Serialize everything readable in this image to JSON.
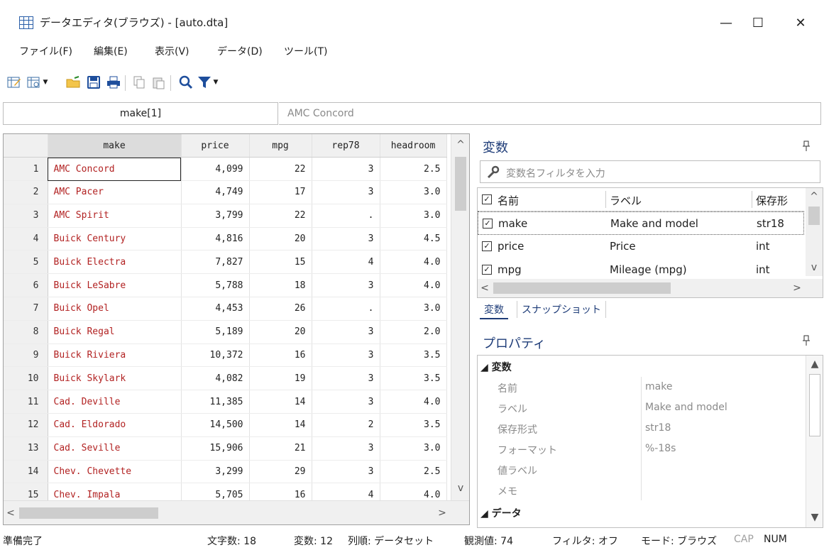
{
  "window": {
    "title": "データエディタ(ブラウズ) - [auto.dta]",
    "minimize": "—",
    "maximize": "☐",
    "close": "✕"
  },
  "menu": [
    "ファイル(F)",
    "編集(E)",
    "表示(V)",
    "データ(D)",
    "ツール(T)"
  ],
  "toolbar": {
    "icons": [
      "data-editor-edit-icon",
      "data-editor-browse-icon",
      "open-folder-icon",
      "save-icon",
      "print-icon",
      "copy-icon",
      "paste-icon",
      "search-icon",
      "filter-icon"
    ]
  },
  "cellbar": {
    "varname": "make[1]",
    "value": "AMC Concord"
  },
  "grid": {
    "columns": [
      "make",
      "price",
      "mpg",
      "rep78",
      "headroom"
    ],
    "rows": [
      {
        "n": "1",
        "make": "AMC Concord",
        "price": "4,099",
        "mpg": "22",
        "rep78": "3",
        "headroom": "2.5"
      },
      {
        "n": "2",
        "make": "AMC Pacer",
        "price": "4,749",
        "mpg": "17",
        "rep78": "3",
        "headroom": "3.0"
      },
      {
        "n": "3",
        "make": "AMC Spirit",
        "price": "3,799",
        "mpg": "22",
        "rep78": ".",
        "headroom": "3.0"
      },
      {
        "n": "4",
        "make": "Buick Century",
        "price": "4,816",
        "mpg": "20",
        "rep78": "3",
        "headroom": "4.5"
      },
      {
        "n": "5",
        "make": "Buick Electra",
        "price": "7,827",
        "mpg": "15",
        "rep78": "4",
        "headroom": "4.0"
      },
      {
        "n": "6",
        "make": "Buick LeSabre",
        "price": "5,788",
        "mpg": "18",
        "rep78": "3",
        "headroom": "4.0"
      },
      {
        "n": "7",
        "make": "Buick Opel",
        "price": "4,453",
        "mpg": "26",
        "rep78": ".",
        "headroom": "3.0"
      },
      {
        "n": "8",
        "make": "Buick Regal",
        "price": "5,189",
        "mpg": "20",
        "rep78": "3",
        "headroom": "2.0"
      },
      {
        "n": "9",
        "make": "Buick Riviera",
        "price": "10,372",
        "mpg": "16",
        "rep78": "3",
        "headroom": "3.5"
      },
      {
        "n": "10",
        "make": "Buick Skylark",
        "price": "4,082",
        "mpg": "19",
        "rep78": "3",
        "headroom": "3.5"
      },
      {
        "n": "11",
        "make": "Cad. Deville",
        "price": "11,385",
        "mpg": "14",
        "rep78": "3",
        "headroom": "4.0"
      },
      {
        "n": "12",
        "make": "Cad. Eldorado",
        "price": "14,500",
        "mpg": "14",
        "rep78": "2",
        "headroom": "3.5"
      },
      {
        "n": "13",
        "make": "Cad. Seville",
        "price": "15,906",
        "mpg": "21",
        "rep78": "3",
        "headroom": "3.0"
      },
      {
        "n": "14",
        "make": "Chev. Chevette",
        "price": "3,299",
        "mpg": "29",
        "rep78": "3",
        "headroom": "2.5"
      },
      {
        "n": "15",
        "make": "Chev. Impala",
        "price": "5,705",
        "mpg": "16",
        "rep78": "4",
        "headroom": "4.0"
      }
    ]
  },
  "variables": {
    "title": "変数",
    "pin": "ᵖ",
    "filter_placeholder": "変数名フィルタを入力",
    "headers": [
      "名前",
      "ラベル",
      "保存形"
    ],
    "items": [
      {
        "name": "make",
        "label": "Make and model",
        "type": "str18"
      },
      {
        "name": "price",
        "label": "Price",
        "type": "int"
      },
      {
        "name": "mpg",
        "label": "Mileage (mpg)",
        "type": "int"
      }
    ],
    "tabs": [
      "変数",
      "スナップショット"
    ]
  },
  "properties": {
    "title": "プロパティ",
    "group1": "◢ 変数",
    "rows": [
      {
        "k": "名前",
        "v": "make"
      },
      {
        "k": "ラベル",
        "v": "Make and model"
      },
      {
        "k": "保存形式",
        "v": "str18"
      },
      {
        "k": "フォーマット",
        "v": "%-18s"
      },
      {
        "k": "値ラベル",
        "v": ""
      },
      {
        "k": "メモ",
        "v": ""
      }
    ],
    "group2": "◢ データ"
  },
  "status": {
    "ready": "準備完了",
    "chars": "文字数: 18",
    "vars": "変数: 12",
    "order": "列順: データセット",
    "obs": "観測値: 74",
    "filter": "フィルタ: オフ",
    "mode": "モード: ブラウズ",
    "cap": "CAP",
    "num": "NUM"
  },
  "colors": {
    "string_text": "#b22222",
    "pane_title": "#1e3c78",
    "filter_icon": "#1e4e9c"
  }
}
